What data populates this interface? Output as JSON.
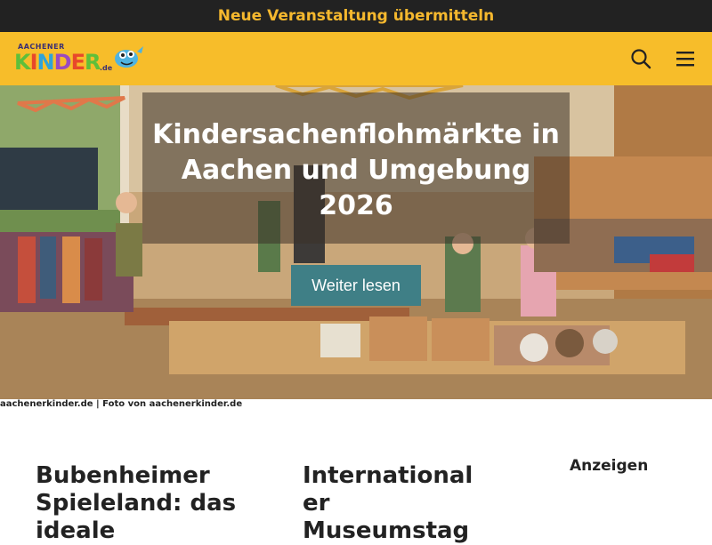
{
  "topbar": {
    "link": "Neue Veranstaltung übermitteln"
  },
  "header": {
    "logo_small": "AACHENER",
    "logo_letters": [
      "K",
      "I",
      "N",
      "D",
      "E",
      "R"
    ],
    "logo_de": ".de",
    "search_icon": "search-icon",
    "menu_icon": "hamburger-menu-icon"
  },
  "hero": {
    "title": "Kindersachenflohmärkte in Aachen und Umgebung 2026",
    "button": "Weiter lesen",
    "caption": "aachenerkinder.de | Foto von aachenerkinder.de"
  },
  "articles": [
    {
      "title": "Bubenheimer Spieleland: das ideale"
    },
    {
      "title": "International er Museumstag"
    }
  ],
  "sidebar": {
    "ads_label": "Anzeigen"
  },
  "colors": {
    "topbar_bg": "#222222",
    "accent": "#f7bd2a",
    "button": "#3f7f86"
  }
}
